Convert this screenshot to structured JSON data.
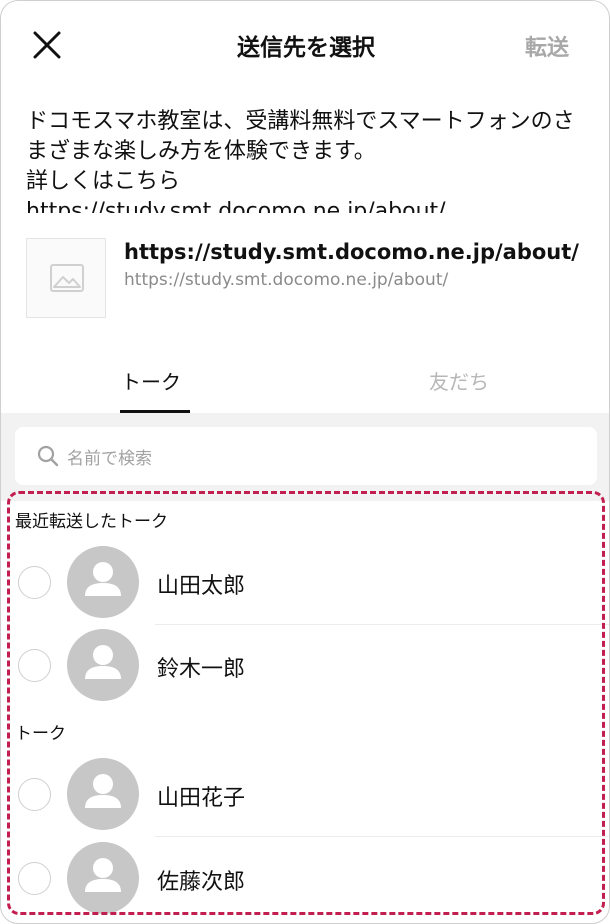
{
  "header": {
    "title": "送信先を選択",
    "forward_label": "転送"
  },
  "message": {
    "text": "ドコモスマホ教室は、受講料無料でスマートフォンのさまざまな楽しみ方を体験できます。\n詳しくはこちら\nhttps://study.smt.docomo.ne.jp/about/"
  },
  "link_preview": {
    "title": "https://study.smt.docomo.ne.jp/about/",
    "url": "https://study.smt.docomo.ne.jp/about/"
  },
  "tabs": [
    {
      "label": "トーク",
      "active": true
    },
    {
      "label": "友だち",
      "active": false
    }
  ],
  "search": {
    "placeholder": "名前で検索"
  },
  "sections": [
    {
      "label": "最近転送したトーク",
      "items": [
        {
          "name": "山田太郎"
        },
        {
          "name": "鈴木一郎"
        }
      ]
    },
    {
      "label": "トーク",
      "items": [
        {
          "name": "山田花子"
        },
        {
          "name": "佐藤次郎"
        }
      ]
    }
  ],
  "colors": {
    "highlight": "#c21e4f",
    "muted": "#a8a8a8",
    "avatar": "#c7c7c7"
  }
}
